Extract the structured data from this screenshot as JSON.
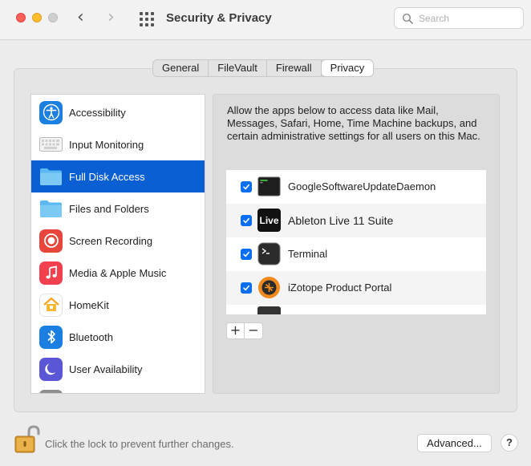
{
  "window": {
    "title": "Security & Privacy",
    "search_placeholder": "Search"
  },
  "tabs": [
    {
      "label": "General"
    },
    {
      "label": "FileVault"
    },
    {
      "label": "Firewall"
    },
    {
      "label": "Privacy",
      "active": true
    }
  ],
  "sidebar": {
    "items": [
      {
        "label": "Accessibility",
        "icon": "accessibility-icon"
      },
      {
        "label": "Input Monitoring",
        "icon": "keyboard-icon"
      },
      {
        "label": "Full Disk Access",
        "icon": "folder-icon",
        "selected": true
      },
      {
        "label": "Files and Folders",
        "icon": "folder-icon"
      },
      {
        "label": "Screen Recording",
        "icon": "screen-recording-icon"
      },
      {
        "label": "Media & Apple Music",
        "icon": "music-icon"
      },
      {
        "label": "HomeKit",
        "icon": "home-icon"
      },
      {
        "label": "Bluetooth",
        "icon": "bluetooth-icon"
      },
      {
        "label": "User Availability",
        "icon": "moon-icon"
      }
    ]
  },
  "main": {
    "description": "Allow the apps below to access data like Mail, Messages, Safari, Home, Time Machine backups, and certain administrative settings for all users on this Mac.",
    "apps": [
      {
        "name": "GoogleSoftwareUpdateDaemon",
        "checked": true,
        "icon": "terminal-exec-icon"
      },
      {
        "name": "Ableton Live 11 Suite",
        "checked": true,
        "icon": "ableton-live-icon",
        "icon_text": "Live"
      },
      {
        "name": "Terminal",
        "checked": true,
        "icon": "terminal-icon"
      },
      {
        "name": "iZotope Product Portal",
        "checked": true,
        "icon": "izotope-icon"
      }
    ],
    "add_label": "+",
    "remove_label": "−"
  },
  "footer": {
    "lock_text": "Click the lock to prevent further changes.",
    "advanced_label": "Advanced...",
    "help_label": "?"
  },
  "colors": {
    "selection": "#0a5fd3",
    "checkbox": "#0a6ef0",
    "close": "#fe5f57",
    "minimize": "#febc2e"
  }
}
